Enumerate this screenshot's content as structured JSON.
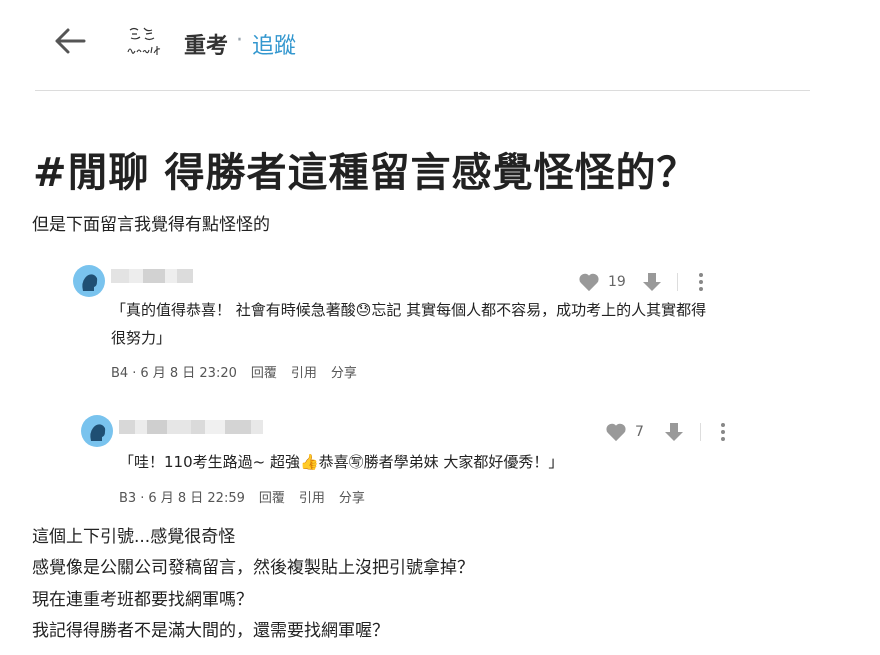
{
  "header": {
    "board_name": "重考",
    "separator": "·",
    "follow_label": "追蹤",
    "logo_text": "重考 Resit"
  },
  "post": {
    "title": "#閒聊 得勝者這種留言感覺怪怪的？",
    "intro": "但是下面留言我覺得有點怪怪的",
    "body_lines": [
      "這個上下引號...感覺很奇怪",
      "感覺像是公關公司發稿留言，然後複製貼上沒把引號拿掉？",
      "現在連重考班都要找網軍嗎？",
      "我記得得勝者不是滿大間的，還需要找網軍喔？"
    ]
  },
  "comments": [
    {
      "text_line1": "「真的值得恭喜！ 社會有時候急著酸😓忘記 其實每個人都不容易，成功考上的人其實都得",
      "text_line2": "很努力」",
      "likes": "19",
      "floor": "B4",
      "date": "6 月 8 日 23:20",
      "reply_label": "回覆",
      "quote_label": "引用",
      "share_label": "分享"
    },
    {
      "text_line1": "「哇！110考生路過~ 超強👍恭喜㊢勝者學弟妹 大家都好優秀！」",
      "likes": "7",
      "floor": "B3",
      "date": "6 月 8 日 22:59",
      "reply_label": "回覆",
      "quote_label": "引用",
      "share_label": "分享"
    }
  ],
  "colors": {
    "accent": "#3397cf",
    "avatar": "#79c3ee",
    "icon_gray": "#999999",
    "divider": "#dcdcdc"
  },
  "icons": {
    "back": "arrow-left-icon",
    "like": "heart-icon",
    "dislike": "arrow-down-icon",
    "more": "more-vertical-icon"
  }
}
